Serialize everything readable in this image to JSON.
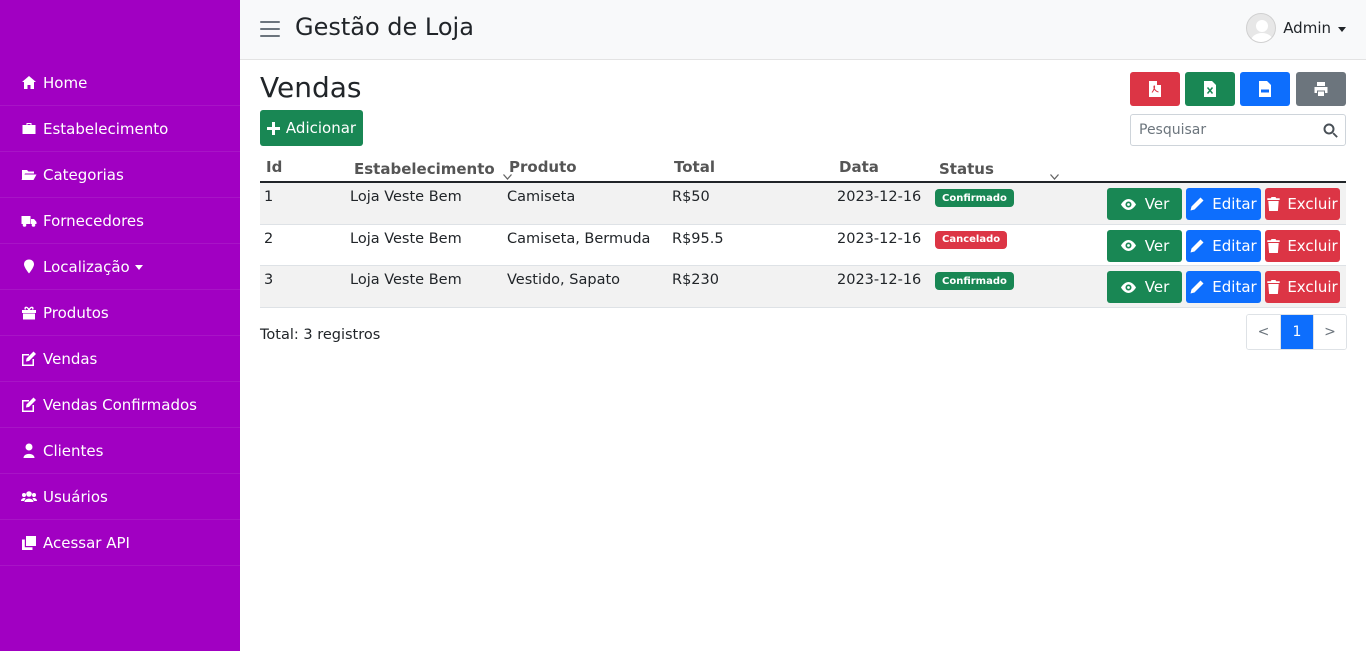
{
  "header": {
    "app_title": "Gestão de Loja",
    "user_name": "Admin"
  },
  "sidebar": {
    "items": [
      {
        "label": "Home",
        "icon": "home-icon"
      },
      {
        "label": "Estabelecimento",
        "icon": "briefcase-icon"
      },
      {
        "label": "Categorias",
        "icon": "folder-open-icon"
      },
      {
        "label": "Fornecedores",
        "icon": "truck-icon"
      },
      {
        "label": "Localização",
        "icon": "map-marker-icon",
        "dropdown": true
      },
      {
        "label": "Produtos",
        "icon": "gift-icon"
      },
      {
        "label": "Vendas",
        "icon": "edit-icon"
      },
      {
        "label": "Vendas Confirmados",
        "icon": "edit-icon"
      },
      {
        "label": "Clientes",
        "icon": "user-icon"
      },
      {
        "label": "Usuários",
        "icon": "users-icon"
      },
      {
        "label": "Acessar API",
        "icon": "clone-icon"
      }
    ]
  },
  "main": {
    "title": "Vendas",
    "add_label": "Adicionar",
    "search_placeholder": "Pesquisar",
    "export_buttons": [
      "pdf-icon",
      "excel-icon",
      "csv-icon",
      "print-icon"
    ],
    "columns": {
      "id": "Id",
      "estabelecimento": "Estabelecimento",
      "produto": "Produto",
      "total": "Total",
      "data": "Data",
      "status": "Status"
    },
    "rows": [
      {
        "id": "1",
        "estabelecimento": "Loja Veste Bem",
        "produto": "Camiseta",
        "total": "R$50",
        "data": "2023-12-16",
        "status": "Confirmado"
      },
      {
        "id": "2",
        "estabelecimento": "Loja Veste Bem",
        "produto": "Camiseta, Bermuda",
        "total": "R$95.5",
        "data": "2023-12-16",
        "status": "Cancelado"
      },
      {
        "id": "3",
        "estabelecimento": "Loja Veste Bem",
        "produto": "Vestido, Sapato",
        "total": "R$230",
        "data": "2023-12-16",
        "status": "Confirmado"
      }
    ],
    "actions": {
      "view": "Ver",
      "edit": "Editar",
      "delete": "Excluir"
    },
    "total_text": "Total: 3 registros",
    "pagination": {
      "prev": "<",
      "current": "1",
      "next": ">"
    }
  },
  "colors": {
    "sidebar_bg": "#a100c2",
    "success": "#198754",
    "primary": "#0d6efd",
    "danger": "#dc3545",
    "secondary": "#6c757d"
  }
}
